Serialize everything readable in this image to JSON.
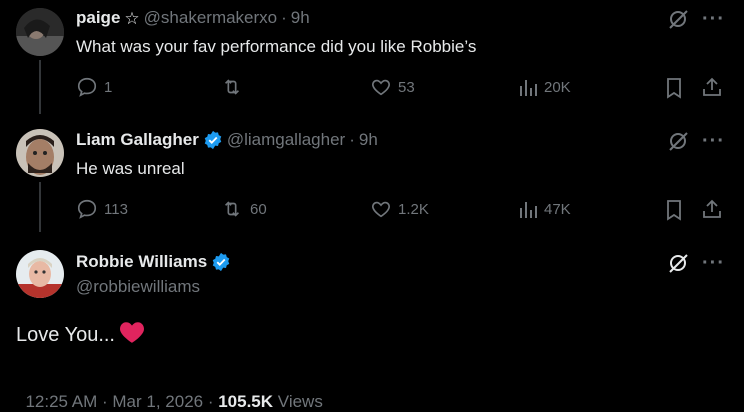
{
  "tweets": [
    {
      "display_name": "paige",
      "handle": "@shakermakerxo",
      "time": "9h",
      "text": "What was your fav performance did you like Robbie’s",
      "replies": "1",
      "retweets": "",
      "likes": "53",
      "views": "20K"
    },
    {
      "display_name": "Liam Gallagher",
      "handle": "@liamgallagher",
      "time": "9h",
      "text": "He was unreal",
      "replies": "113",
      "retweets": "60",
      "likes": "1.2K",
      "views": "47K"
    }
  ],
  "main": {
    "display_name": "Robbie Williams",
    "handle": "@robbiewilliams",
    "text": "Love You...",
    "emoji": "❤️",
    "timestamp": "12:25 AM · Mar 1, 2026 · ",
    "views_count": "105.5K",
    "views_label": "Views"
  },
  "colors": {
    "background": "#000000",
    "text": "#e7e9ea",
    "muted": "#71767b",
    "verified": "#1d9bf0",
    "heart": "#e0245e"
  },
  "icons": {
    "reply": "reply-icon",
    "retweet": "retweet-icon",
    "like": "heart-icon",
    "views": "views-icon",
    "bookmark": "bookmark-icon",
    "share": "share-icon",
    "grok": "grok-icon",
    "more": "more-icon",
    "star": "star-icon",
    "verified": "verified-badge-icon"
  }
}
